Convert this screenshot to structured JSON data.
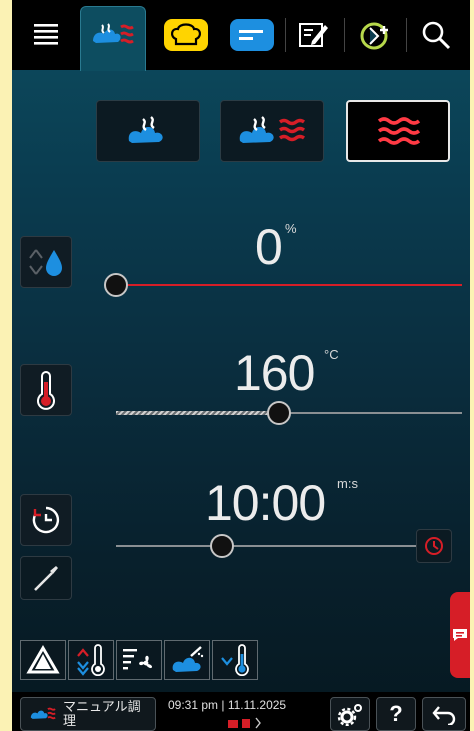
{
  "topbar": {
    "icons": [
      "menu-icon",
      "steam-heat-icon",
      "chef-hat-icon",
      "recipe-list-icon",
      "edit-note-icon",
      "refresh-plus-icon",
      "search-icon"
    ]
  },
  "mode_buttons": [
    "steam-icon",
    "combi-steam-hot-air-icon",
    "hot-air-icon"
  ],
  "humidity": {
    "value": "0",
    "unit": "%",
    "level_percent": 0
  },
  "temperature": {
    "value": "160",
    "unit": "°C",
    "level_fraction": 0.47
  },
  "time": {
    "value": "10:00",
    "unit": "m:s",
    "level_fraction": 0.34
  },
  "status": {
    "mode_label": "マニュアル調理",
    "datetime": "09:31 pm | 11.11.2025"
  },
  "colors": {
    "accent_red": "#d61e27",
    "accent_blue": "#1d8fe0",
    "accent_yellow": "#ffd400",
    "tab_bg": "#0d4d60"
  }
}
